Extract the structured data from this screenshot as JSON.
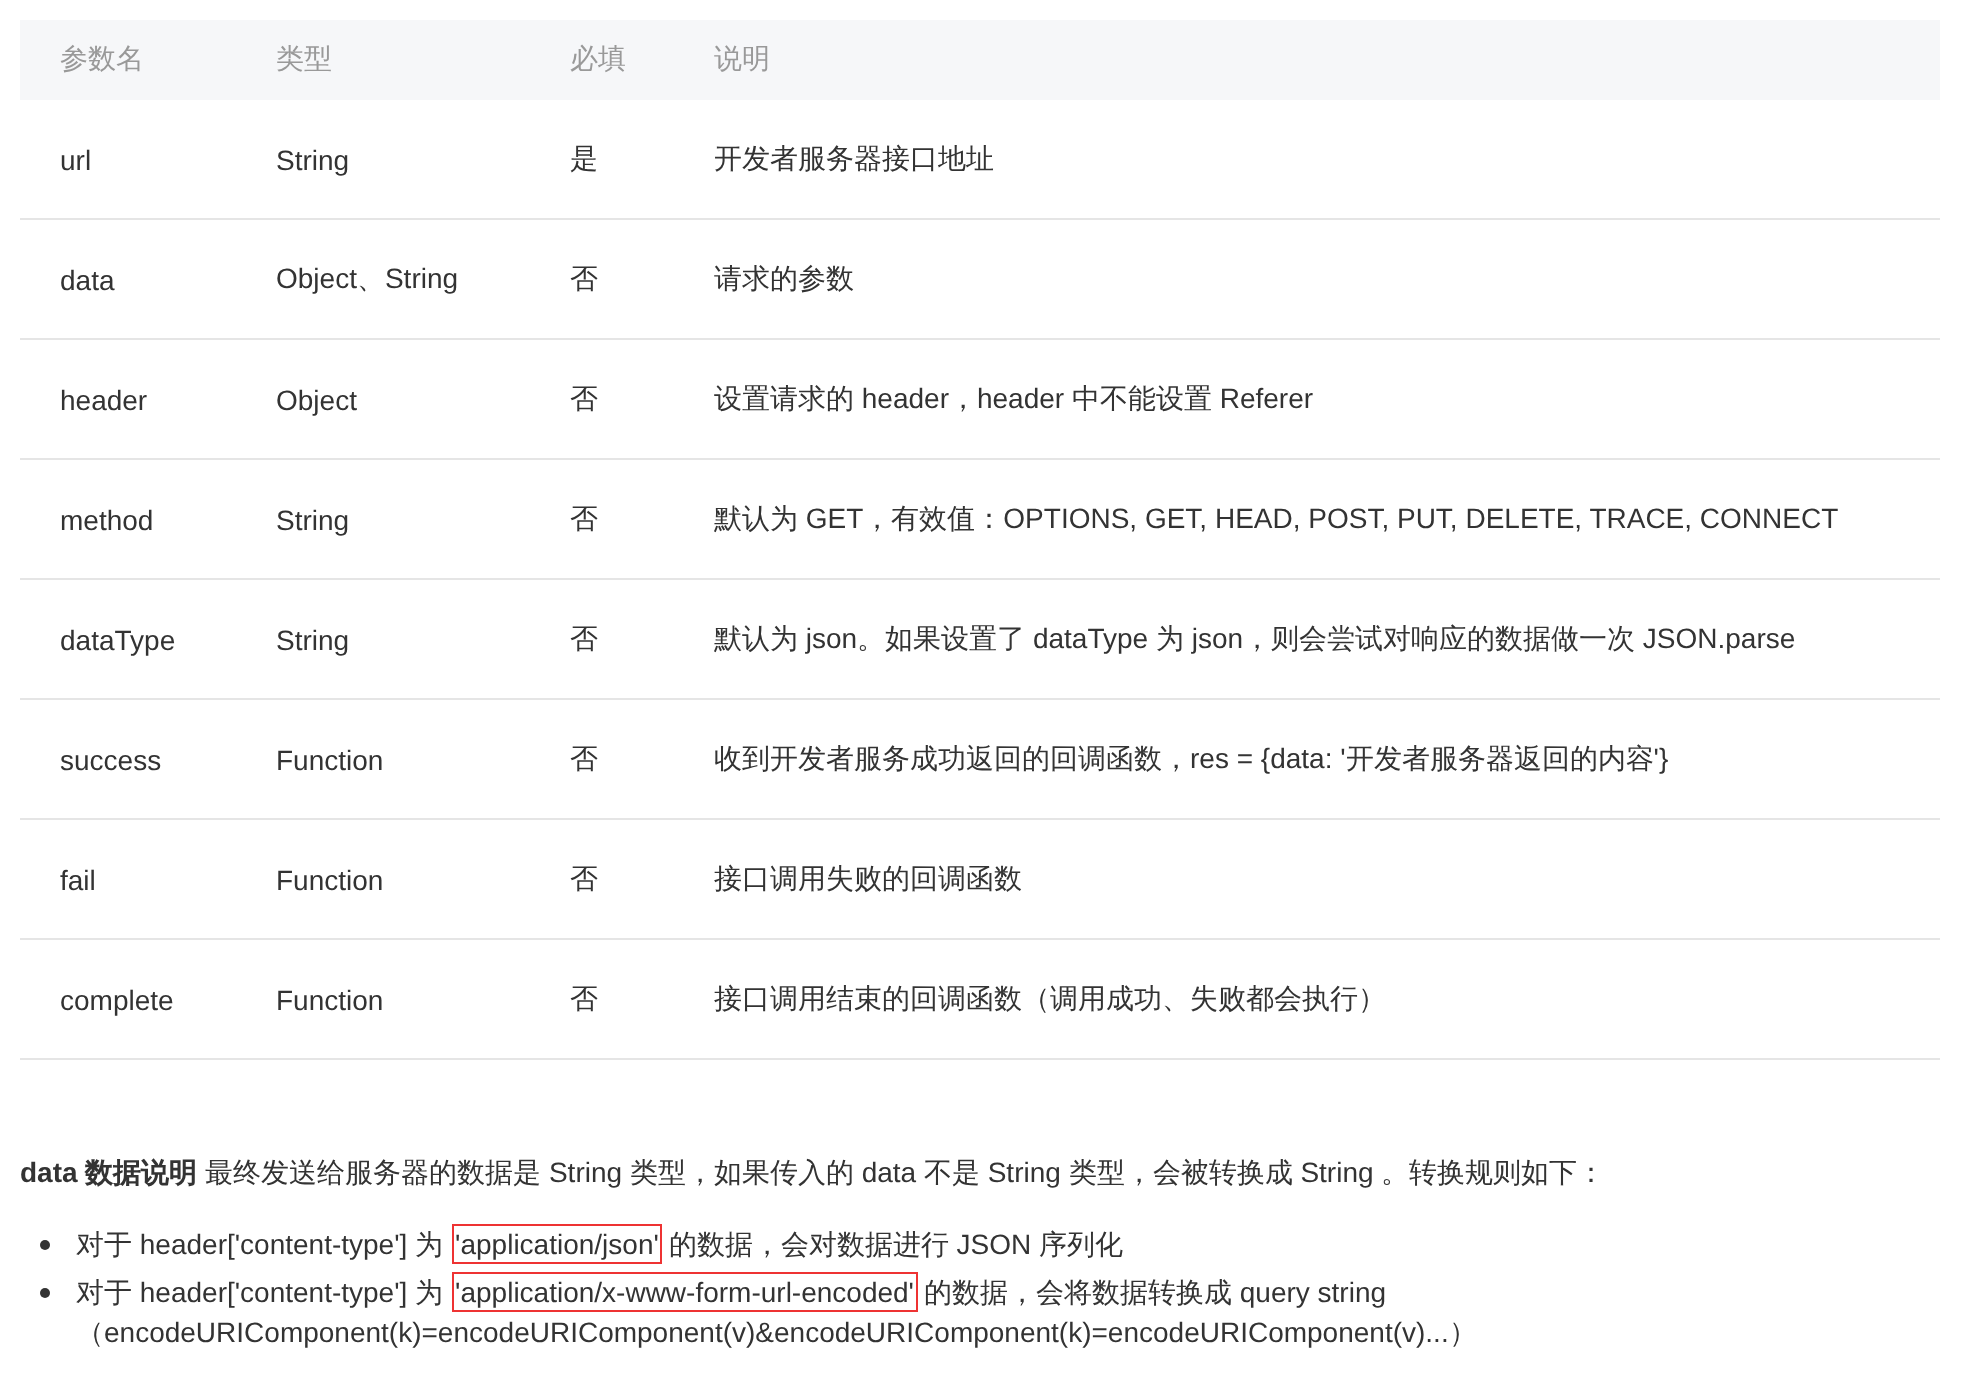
{
  "table": {
    "columns": [
      "参数名",
      "类型",
      "必填",
      "说明"
    ],
    "rows": [
      {
        "cells": [
          "url",
          "String",
          "是",
          "开发者服务器接口地址"
        ]
      },
      {
        "cells": [
          "data",
          "Object、String",
          "否",
          "请求的参数"
        ]
      },
      {
        "cells": [
          "header",
          "Object",
          "否",
          "设置请求的 header，header 中不能设置 Referer"
        ]
      },
      {
        "cells": [
          "method",
          "String",
          "否",
          "默认为 GET，有效值：OPTIONS, GET, HEAD, POST, PUT, DELETE, TRACE, CONNECT"
        ]
      },
      {
        "cells": [
          "dataType",
          "String",
          "否",
          "默认为 json。如果设置了 dataType 为 json，则会尝试对响应的数据做一次 JSON.parse"
        ]
      },
      {
        "cells": [
          "success",
          "Function",
          "否",
          "收到开发者服务成功返回的回调函数，res = {data: '开发者服务器返回的内容'}"
        ]
      },
      {
        "cells": [
          "fail",
          "Function",
          "否",
          "接口调用失败的回调函数"
        ]
      },
      {
        "cells": [
          "complete",
          "Function",
          "否",
          "接口调用结束的回调函数（调用成功、失败都会执行）"
        ]
      }
    ]
  },
  "note": {
    "text": "**data 数据说明** 最终发送给服务器的数据是 String 类型，如果传入的 data 不是 String 类型，会被转换成 String 。转换规则如下：",
    "bullets": [
      {
        "before": "对于 header['content-type'] 为",
        "highlighted": "'application/json'",
        "after": "的数据，会对数据进行 JSON 序列化"
      },
      {
        "before": "对于 header['content-type'] 为",
        "highlighted": "'application/x-www-form-url-encoded'",
        "after": "的数据，会将数据转换成 query string",
        "continuation": "（encodeURIComponent(k)=encodeURIComponent(v)&encodeURIComponent(k)=encodeURIComponent(v)...）"
      }
    ]
  }
}
